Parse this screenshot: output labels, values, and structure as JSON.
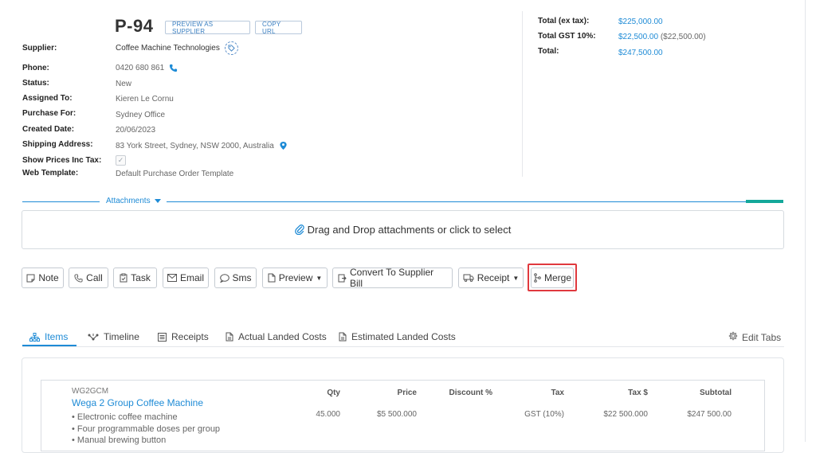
{
  "header": {
    "po_number": "P-94",
    "preview_as_supplier": "PREVIEW AS SUPPLIER",
    "copy_url": "COPY URL"
  },
  "fields": [
    {
      "label": "Supplier:",
      "value": "Coffee Machine Technologies"
    },
    {
      "label": "Phone:",
      "value": "0420 680 861"
    },
    {
      "label": "Status:",
      "value": "New"
    },
    {
      "label": "Assigned To:",
      "value": "Kieren Le Cornu"
    },
    {
      "label": "Purchase For:",
      "value": "Sydney Office"
    },
    {
      "label": "Created Date:",
      "value": "20/06/2023"
    },
    {
      "label": "Shipping Address:",
      "value": "83 York Street, Sydney, NSW 2000, Australia"
    },
    {
      "label": "Show Prices Inc Tax:",
      "value": "✓"
    },
    {
      "label": "Web Template:",
      "value": "Default Purchase Order Template"
    }
  ],
  "totals": {
    "ex_tax_label": "Total (ex tax):",
    "ex_tax_value": "$225,000.00",
    "gst_label": "Total GST 10%:",
    "gst_value": "$22,500.00",
    "gst_paren": "($22,500.00)",
    "total_label": "Total:",
    "total_value": "$247,500.00"
  },
  "attachments": {
    "title": "Attachments",
    "dropzone_text": "Drag and Drop attachments or click to select"
  },
  "actions": {
    "note": "Note",
    "call": "Call",
    "task": "Task",
    "email": "Email",
    "sms": "Sms",
    "preview": "Preview",
    "convert": "Convert To Supplier Bill",
    "receipt": "Receipt",
    "merge": "Merge"
  },
  "tabs": {
    "items": "Items",
    "timeline": "Timeline",
    "receipts": "Receipts",
    "actual_landed": "Actual Landed Costs",
    "estimated_landed": "Estimated Landed Costs",
    "edit_tabs": "Edit Tabs"
  },
  "items_table": {
    "headers": {
      "qty": "Qty",
      "price": "Price",
      "discount": "Discount %",
      "tax": "Tax",
      "tax_amount": "Tax $",
      "subtotal": "Subtotal"
    },
    "rows": [
      {
        "sku": "WG2GCM",
        "name": "Wega 2 Group Coffee Machine",
        "bullets": [
          "• Electronic coffee machine",
          "• Four programmable doses per group",
          "• Manual brewing button"
        ],
        "qty": "45.000",
        "price": "$5 500.000",
        "discount": "",
        "tax": "GST (10%)",
        "tax_amount": "$22 500.000",
        "subtotal": "$247 500.00"
      }
    ]
  },
  "colors": {
    "accent": "#1e8bd6",
    "teal": "#14a89a",
    "highlight": "#e0393e"
  }
}
